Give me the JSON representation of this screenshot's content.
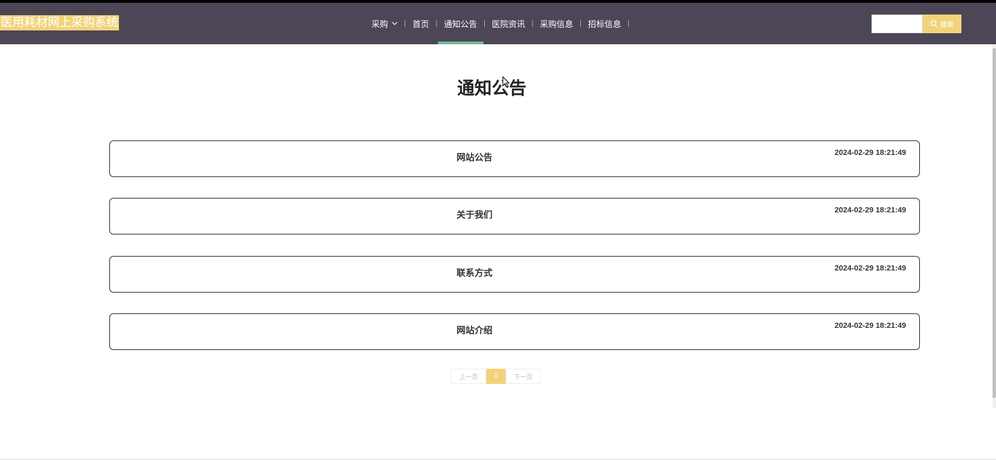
{
  "header": {
    "logo": "医用耗材网上采购系统",
    "menu": [
      {
        "label": "采购",
        "dropdown": true
      },
      {
        "label": "首页"
      },
      {
        "label": "通知公告",
        "active": true
      },
      {
        "label": "医院资讯"
      },
      {
        "label": "采购信息"
      },
      {
        "label": "招标信息"
      }
    ],
    "search": {
      "value": "",
      "button_label": "搜索",
      "icon": "search-icon"
    }
  },
  "main": {
    "title": "通知公告",
    "notices": [
      {
        "title": "网站公告",
        "time": "2024-02-29 18:21:49"
      },
      {
        "title": "关于我们",
        "time": "2024-02-29 18:21:49"
      },
      {
        "title": "联系方式",
        "time": "2024-02-29 18:21:49"
      },
      {
        "title": "网站介绍",
        "time": "2024-02-29 18:21:49"
      }
    ],
    "pagination": {
      "prev": "上一页",
      "current": "1",
      "next": "下一页"
    }
  },
  "colors": {
    "navbar": "#4c4657",
    "accent": "#f2d37b",
    "active_underline": "#6fb98f"
  }
}
